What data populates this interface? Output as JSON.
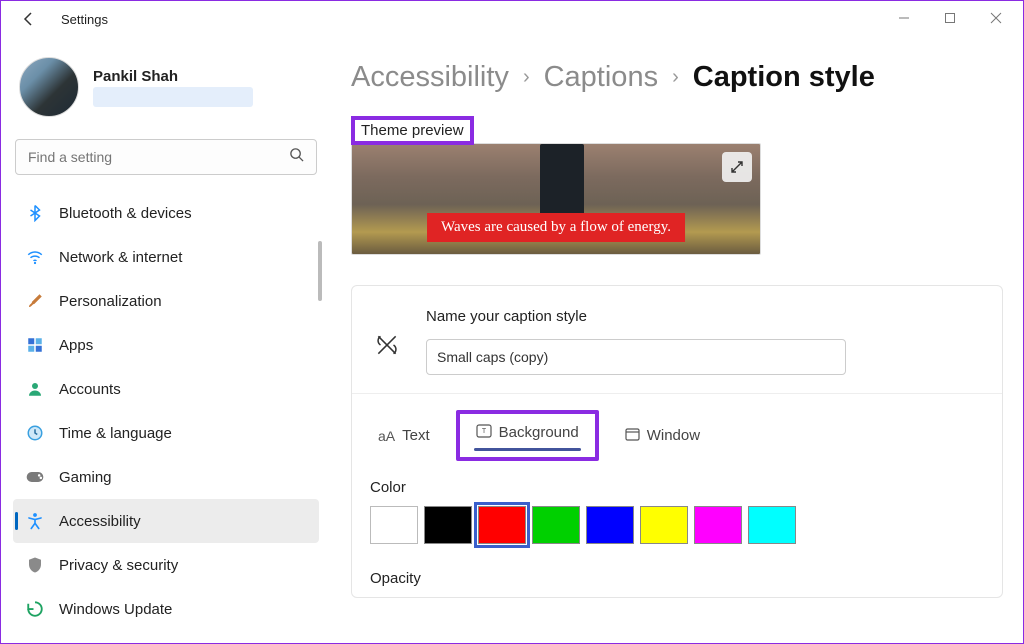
{
  "window": {
    "title": "Settings"
  },
  "profile": {
    "name": "Pankil Shah"
  },
  "search": {
    "placeholder": "Find a setting"
  },
  "sidebar": {
    "items": [
      {
        "label": "Bluetooth & devices",
        "icon": "bluetooth",
        "color": "#1e90ff"
      },
      {
        "label": "Network & internet",
        "icon": "wifi",
        "color": "#1e90ff"
      },
      {
        "label": "Personalization",
        "icon": "brush",
        "color": "#c77b3a"
      },
      {
        "label": "Apps",
        "icon": "apps",
        "color": "#3470d6"
      },
      {
        "label": "Accounts",
        "icon": "person",
        "color": "#2aa876"
      },
      {
        "label": "Time & language",
        "icon": "clock",
        "color": "#3aa0e0"
      },
      {
        "label": "Gaming",
        "icon": "gamepad",
        "color": "#7a7a7a"
      },
      {
        "label": "Accessibility",
        "icon": "accessibility",
        "color": "#1e90ff",
        "active": true
      },
      {
        "label": "Privacy & security",
        "icon": "shield",
        "color": "#8a8a8a"
      },
      {
        "label": "Windows Update",
        "icon": "update",
        "color": "#1ea362"
      }
    ]
  },
  "breadcrumb": {
    "items": [
      "Accessibility",
      "Captions",
      "Caption style"
    ]
  },
  "preview": {
    "section_label": "Theme preview",
    "caption_text": "Waves are caused by a flow of energy.",
    "caption_bg": "#e02424",
    "caption_fg": "#ffffff"
  },
  "style_editor": {
    "name_label": "Name your caption style",
    "name_value": "Small caps (copy)",
    "tabs": [
      {
        "label": "Text"
      },
      {
        "label": "Background",
        "active": true
      },
      {
        "label": "Window"
      }
    ],
    "color_label": "Color",
    "colors": [
      "#ffffff",
      "#000000",
      "#ff0000",
      "#00d000",
      "#0000ff",
      "#ffff00",
      "#ff00ff",
      "#00ffff"
    ],
    "selected_color_index": 2,
    "opacity_label": "Opacity"
  }
}
